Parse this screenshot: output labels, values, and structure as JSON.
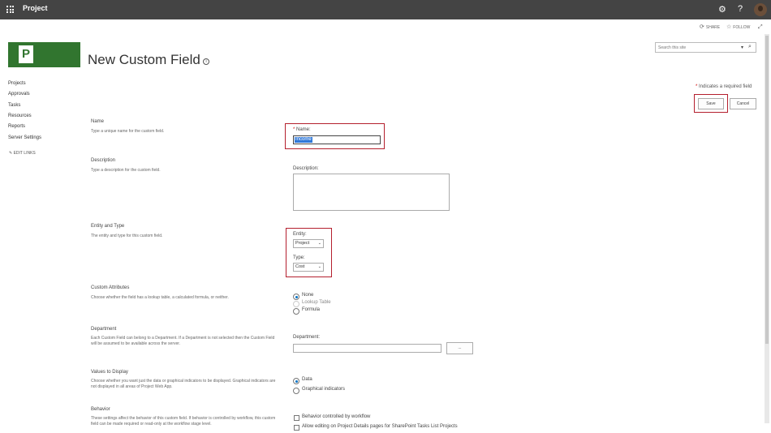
{
  "suitebar": {
    "app_name": "Project"
  },
  "actions": {
    "share": "SHARE",
    "follow": "FOLLOW"
  },
  "search": {
    "placeholder": "Search this site"
  },
  "page": {
    "title": "New Custom Field"
  },
  "nav": {
    "items": [
      "Projects",
      "Approvals",
      "Tasks",
      "Resources",
      "Reports",
      "Server Settings"
    ],
    "edit_links": "EDIT LINKS"
  },
  "required_note": "Indicates a required field",
  "buttons": {
    "save": "Save",
    "cancel": "Cancel",
    "browse": "..."
  },
  "sections": {
    "name": {
      "title": "Name",
      "desc": "Type a unique name for the custom field.",
      "label": "Name:",
      "value": "Income"
    },
    "description": {
      "title": "Description",
      "desc": "Type a description for the custom field.",
      "label": "Description:"
    },
    "entity_type": {
      "title": "Entity and Type",
      "desc": "The entity and type for this custom field.",
      "entity_label": "Entity:",
      "entity_value": "Project",
      "type_label": "Type:",
      "type_value": "Cost"
    },
    "custom_attributes": {
      "title": "Custom Attributes",
      "desc": "Choose whether the field has a lookup table, a calculated formula, or neither.",
      "options": [
        "None",
        "Lookup Table",
        "Formula"
      ]
    },
    "department": {
      "title": "Department",
      "desc": "Each Custom Field can belong to a Department. If a Department is not selected then the Custom Field will be assumed to be available across the server.",
      "label": "Department:"
    },
    "values_display": {
      "title": "Values to Display",
      "desc": "Choose whether you want just the data or graphical indicators to be displayed. Graphical indicators are not displayed in all areas of Project Web App.",
      "options": [
        "Data",
        "Graphical indicators"
      ]
    },
    "behavior": {
      "title": "Behavior",
      "desc": "These settings affect the behavior of this custom field. If behavior is controlled by workflow, this custom field can be made required or read-only at the workflow stage level.",
      "options": [
        "Behavior controlled by workflow",
        "Allow editing on Project Details pages for SharePoint Tasks List Projects"
      ]
    }
  },
  "colors": {
    "suitebar": "#444444",
    "logo": "#31752f",
    "highlight": "#b41f2d",
    "accent": "#0072c6"
  }
}
